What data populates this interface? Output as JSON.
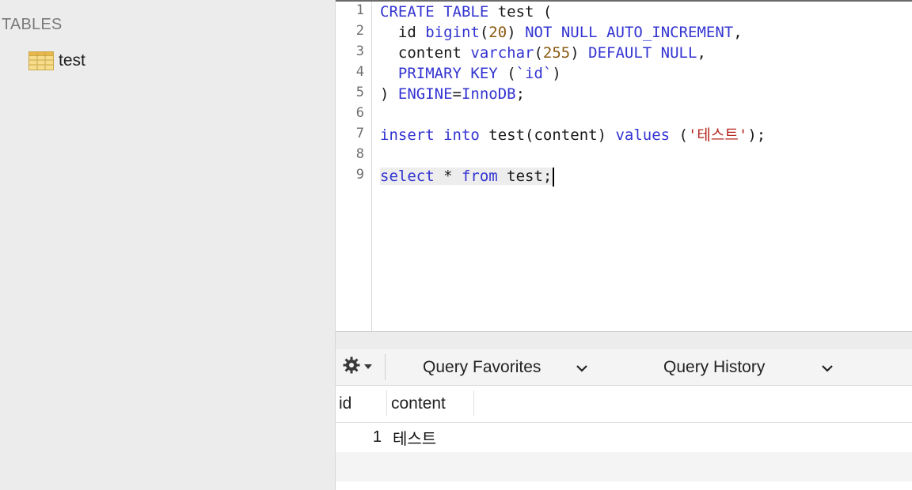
{
  "sidebar": {
    "heading": "TABLES",
    "items": [
      {
        "label": "test",
        "icon": "table-icon"
      }
    ]
  },
  "editor": {
    "line_numbers": [
      "1",
      "2",
      "3",
      "4",
      "5",
      "6",
      "7",
      "8",
      "9"
    ],
    "lines": [
      "CREATE TABLE test (",
      "  id bigint(20) NOT NULL AUTO_INCREMENT,",
      "  content varchar(255) DEFAULT NULL,",
      "  PRIMARY KEY (`id`)",
      ") ENGINE=InnoDB;",
      "",
      "insert into test(content) values ('테스트');",
      "",
      "select * from test;"
    ]
  },
  "toolbar": {
    "gear_icon": "gear-icon",
    "favorites_label": "Query Favorites",
    "history_label": "Query History"
  },
  "results": {
    "columns": [
      "id",
      "content"
    ],
    "rows": [
      [
        "1",
        "테스트"
      ]
    ]
  },
  "colors": {
    "keyword": "#3334d1",
    "number": "#8a5a10",
    "string": "#b3261e",
    "sidebar_bg": "#ececec"
  }
}
